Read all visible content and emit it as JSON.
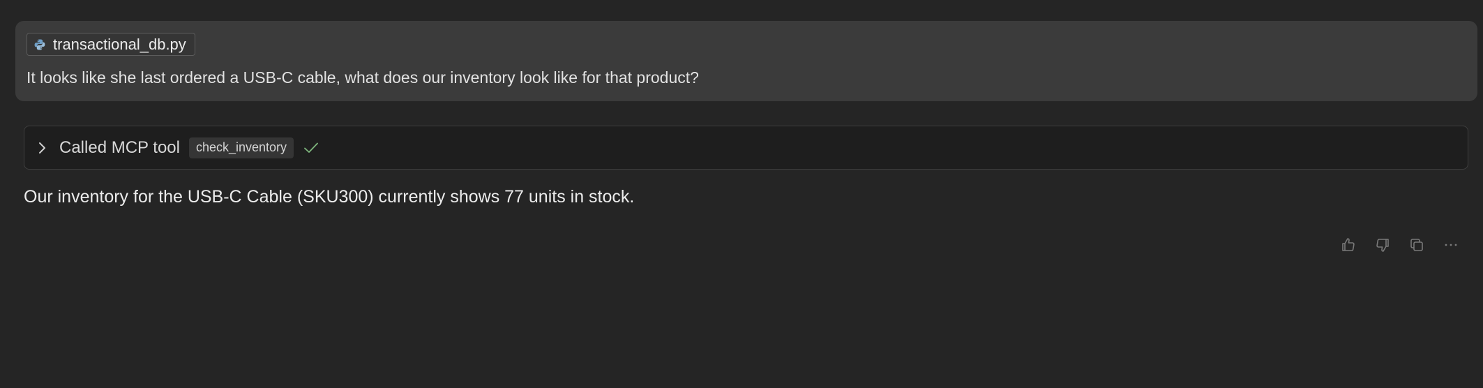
{
  "user_message": {
    "attachment": {
      "file_name": "transactional_db.py",
      "icon": "python-file-icon"
    },
    "text": "It looks like she last ordered a USB-C cable, what does our inventory look like for that product?"
  },
  "tool_call": {
    "label": "Called MCP tool",
    "tool_name": "check_inventory",
    "status": "success",
    "collapsed": true
  },
  "assistant_message": {
    "text": "Our inventory for the USB-C Cable (SKU300) currently shows 77 units in stock."
  },
  "actions": {
    "icons": [
      "thumbs-up-icon",
      "thumbs-down-icon",
      "copy-icon",
      "more-options-icon"
    ]
  },
  "colors": {
    "background": "#252525",
    "user_bubble": "#3b3b3b",
    "tool_box": "#1e1e1e",
    "success_check": "#7fb77e",
    "python_icon": "#6f9fc7"
  }
}
